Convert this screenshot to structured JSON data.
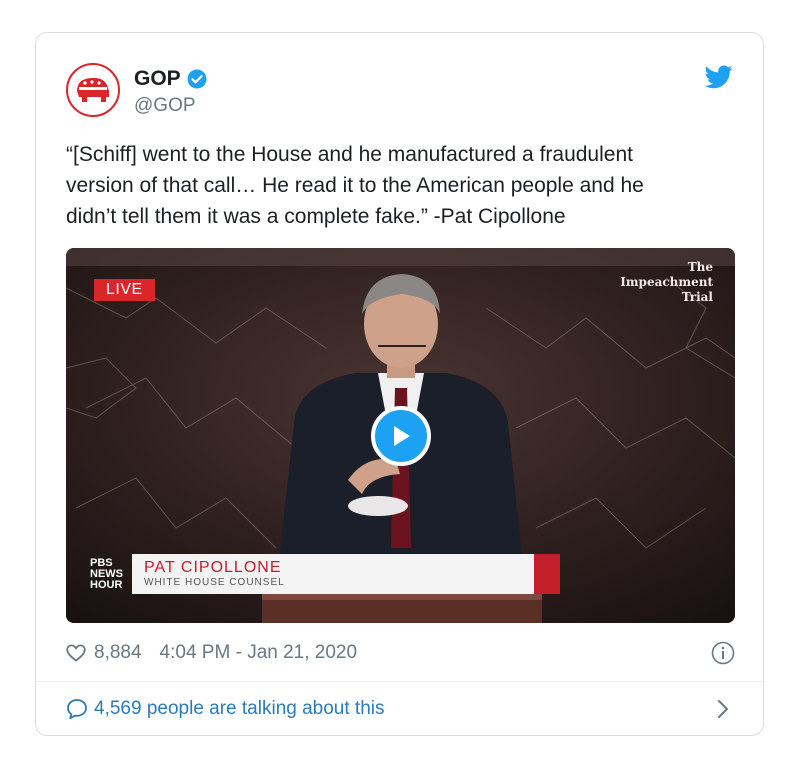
{
  "tweet": {
    "author_name": "GOP",
    "handle": "@GOP",
    "text": "“[Schiff] went to the House and he manufactured a fraudulent\nversion of that call… He read it to the American people and he\ndidn’t tell them it was a complete fake.” -Pat Cipollone",
    "likes": "8,884",
    "timestamp": "4:04 PM - Jan 21, 2020",
    "talking_about": "4,569 people are talking about this"
  },
  "media": {
    "live_label": "LIVE",
    "show_title_line1": "The",
    "show_title_line2": "Impeachment",
    "show_title_line3": "Trial",
    "lower_third_name": "PAT CIPOLLONE",
    "lower_third_title": "WHITE HOUSE COUNSEL",
    "network_logo_line1": "PBS",
    "network_logo_line2": "NEWS",
    "network_logo_line3": "HOUR"
  },
  "icons": {
    "avatar": "gop-elephant-icon",
    "verified": "verified-badge-icon",
    "brand": "twitter-bird-icon",
    "play": "play-icon",
    "like": "heart-icon",
    "info": "info-icon",
    "reply": "speech-bubble-icon",
    "more": "chevron-right-icon"
  },
  "colors": {
    "brand_blue": "#1da1f2",
    "link_blue": "#2b7bb9",
    "gop_red": "#d8262b",
    "muted_text": "#697882"
  }
}
